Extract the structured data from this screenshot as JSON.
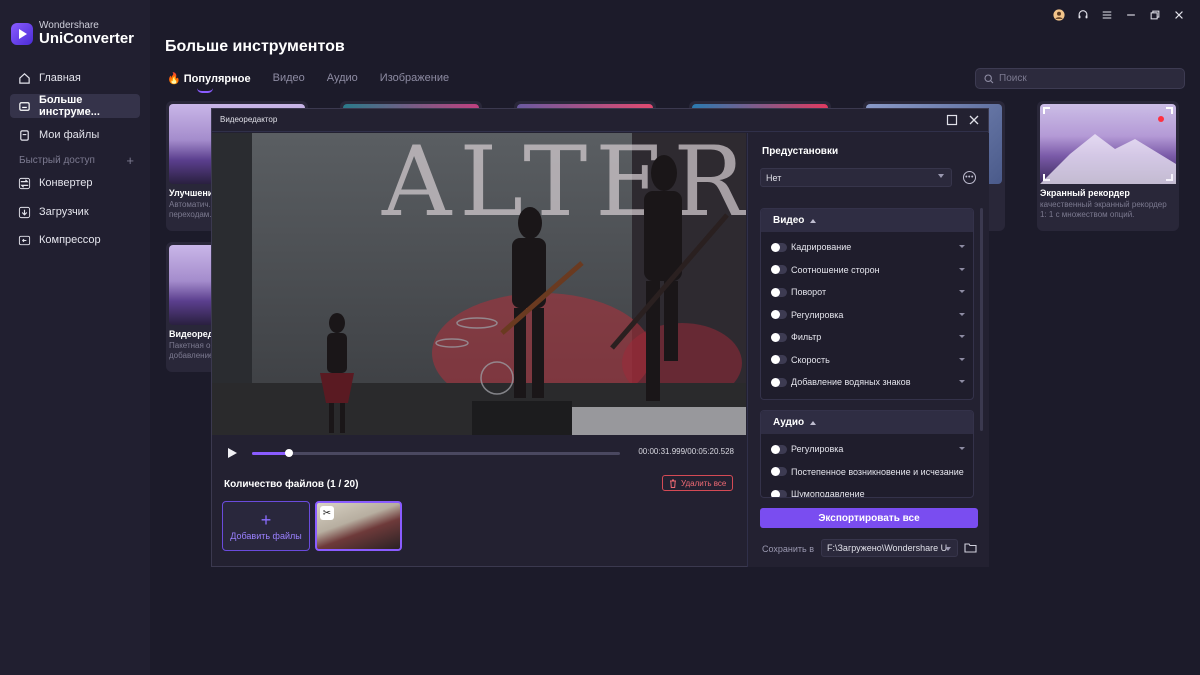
{
  "app": {
    "brand_small": "Wondershare",
    "brand_name": "UniConverter"
  },
  "sidebar": {
    "items": [
      {
        "label": "Главная",
        "icon": "home-icon"
      },
      {
        "label": "Больше инструме...",
        "icon": "toolbox-icon",
        "active": true
      },
      {
        "label": "Мои файлы",
        "icon": "file-icon"
      }
    ],
    "quick_access_label": "Быстрый доступ",
    "quick_items": [
      {
        "label": "Конвертер",
        "icon": "converter-icon"
      },
      {
        "label": "Загрузчик",
        "icon": "download-icon"
      },
      {
        "label": "Компрессор",
        "icon": "compress-icon"
      }
    ]
  },
  "header": {
    "title": "Больше инструментов",
    "tabs": [
      "Популярное",
      "Видео",
      "Аудио",
      "Изображение"
    ],
    "active_tab": "Популярное",
    "search_placeholder": "Поиск"
  },
  "cards": [
    {
      "title": "Улучшение",
      "desc": "Автоматич... видео благ... переходам."
    },
    {
      "title": "Экранный рекордер",
      "desc": "качественный экранный рекордер 1: 1 с множеством опций."
    },
    {
      "title": "Видеоредак",
      "desc": "Пакетная об... кадрирован... добавление"
    }
  ],
  "editor": {
    "title": "Видеоредактор",
    "timecode": "00:00:31.999/00:05:20.528",
    "progress": 0.1,
    "file_count_label": "Количество файлов (1 / 20)",
    "delete_all": "Удалить все",
    "add_files": "Добавить файлы",
    "video_banner_text": "ALTER"
  },
  "panel": {
    "presets_label": "Предустановки",
    "preset_value": "Нет",
    "video_section": "Видео",
    "video_rows": [
      "Кадрирование",
      "Соотношение сторон",
      "Поворот",
      "Регулировка",
      "Фильтр",
      "Скорость",
      "Добавление водяных знаков"
    ],
    "audio_section": "Аудио",
    "audio_rows": [
      "Регулировка",
      "Постепенное возникновение и исчезание",
      "Шумоподавление"
    ],
    "export_label": "Экспортировать все",
    "save_label": "Сохранить в",
    "save_path": "F:\\Загружено\\Wondershare U"
  },
  "colors": {
    "accent": "#7a4df0",
    "danger": "#d44a55",
    "background": "#1c1b2a",
    "sidebar": "#211f30"
  }
}
